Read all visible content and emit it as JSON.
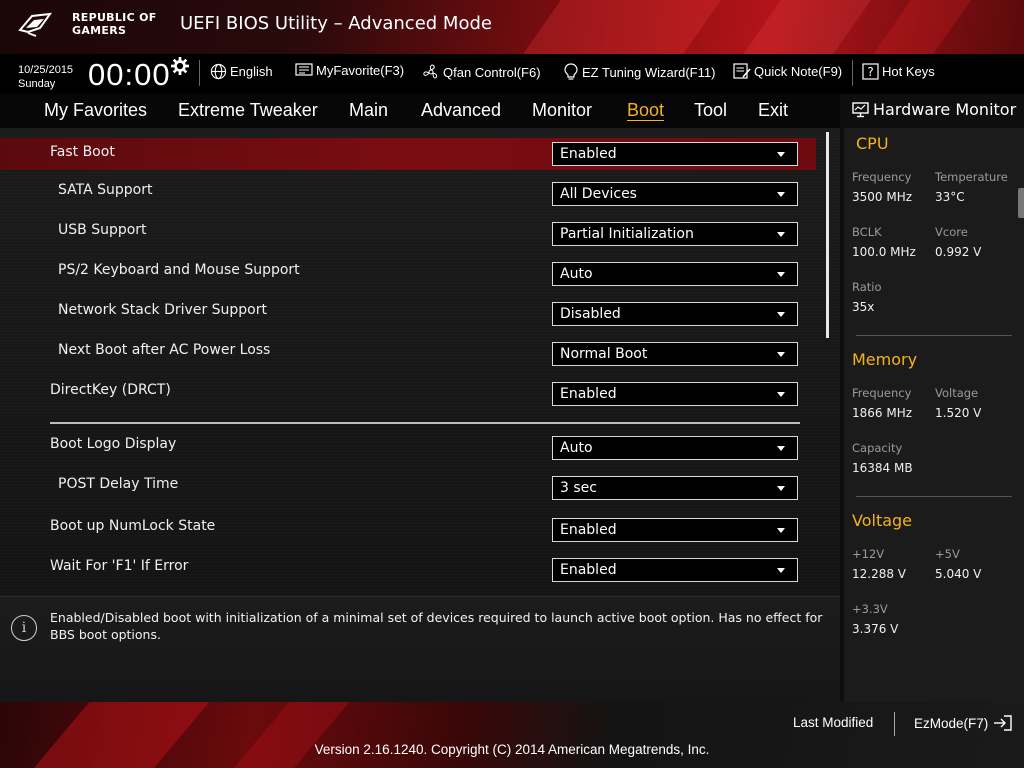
{
  "brand": {
    "logo_line1": "REPUBLIC OF",
    "logo_line2": "GAMERS",
    "title": "UEFI BIOS Utility – Advanced Mode"
  },
  "status": {
    "date": "10/25/2015",
    "day": "Sunday",
    "time": "00:00"
  },
  "toolbar": {
    "language": "English",
    "my_favorite": "MyFavorite(F3)",
    "qfan": "Qfan Control(F6)",
    "ez_tuning": "EZ Tuning Wizard(F11)",
    "quick_note": "Quick Note(F9)",
    "hot_keys": "Hot Keys"
  },
  "tabs": [
    {
      "label": "My Favorites"
    },
    {
      "label": "Extreme Tweaker"
    },
    {
      "label": "Main"
    },
    {
      "label": "Advanced"
    },
    {
      "label": "Monitor"
    },
    {
      "label": "Boot",
      "active": true
    },
    {
      "label": "Tool"
    },
    {
      "label": "Exit"
    }
  ],
  "settings": [
    {
      "label": "Fast Boot",
      "value": "Enabled",
      "selected": true
    },
    {
      "label": "SATA Support",
      "value": "All Devices"
    },
    {
      "label": "USB Support",
      "value": "Partial Initialization"
    },
    {
      "label": "PS/2 Keyboard and Mouse Support",
      "value": "Auto"
    },
    {
      "label": "Network Stack Driver Support",
      "value": "Disabled"
    },
    {
      "label": "Next Boot after AC Power Loss",
      "value": "Normal Boot"
    },
    {
      "label": "DirectKey (DRCT)",
      "value": "Enabled"
    },
    {
      "label": "Boot Logo Display",
      "value": "Auto"
    },
    {
      "label": "POST Delay Time",
      "value": "3 sec"
    },
    {
      "label": "Boot up NumLock State",
      "value": "Enabled"
    },
    {
      "label": "Wait For 'F1' If Error",
      "value": "Enabled"
    }
  ],
  "help": {
    "text": "Enabled/Disabled boot with initialization of a minimal set of devices required to launch active boot option. Has no effect for BBS boot options."
  },
  "hardware_monitor": {
    "title": "Hardware Monitor",
    "cpu": {
      "heading": "CPU",
      "frequency_label": "Frequency",
      "frequency": "3500 MHz",
      "temperature_label": "Temperature",
      "temperature": "33°C",
      "bclk_label": "BCLK",
      "bclk": "100.0 MHz",
      "vcore_label": "Vcore",
      "vcore": "0.992 V",
      "ratio_label": "Ratio",
      "ratio": "35x"
    },
    "memory": {
      "heading": "Memory",
      "frequency_label": "Frequency",
      "frequency": "1866 MHz",
      "voltage_label": "Voltage",
      "voltage": "1.520 V",
      "capacity_label": "Capacity",
      "capacity": "16384 MB"
    },
    "voltage": {
      "heading": "Voltage",
      "v12_label": "+12V",
      "v12": "12.288 V",
      "v5_label": "+5V",
      "v5": "5.040 V",
      "v33_label": "+3.3V",
      "v33": "3.376 V"
    }
  },
  "footer": {
    "last_modified": "Last Modified",
    "ezmode": "EzMode(F7)",
    "version": "Version 2.16.1240. Copyright (C) 2014 American Megatrends, Inc."
  },
  "colors": {
    "accent": "#f5b21a",
    "brand_red": "#b3141a",
    "selected_row": "#7a0d12"
  },
  "icons": [
    "rog-eye-icon",
    "gear-icon",
    "globe-icon",
    "favorite-icon",
    "fan-icon",
    "lightbulb-icon",
    "note-icon",
    "help-icon",
    "monitor-icon",
    "info-icon",
    "exit-arrow-icon"
  ]
}
